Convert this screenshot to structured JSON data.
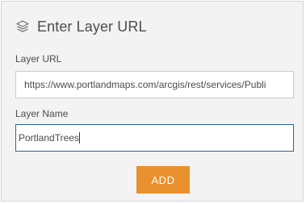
{
  "header": {
    "title": "Enter Layer URL",
    "icon": "layers-icon"
  },
  "form": {
    "url_label": "Layer URL",
    "url_value": "https://www.portlandmaps.com/arcgis/rest/services/Publi",
    "name_label": "Layer Name",
    "name_value": "PortlandTrees"
  },
  "actions": {
    "add_label": "ADD"
  },
  "colors": {
    "panel_background": "#f3f3f3",
    "accent_button": "#e8912e",
    "focus_border": "#2a6496",
    "text": "#4c4c4c"
  }
}
